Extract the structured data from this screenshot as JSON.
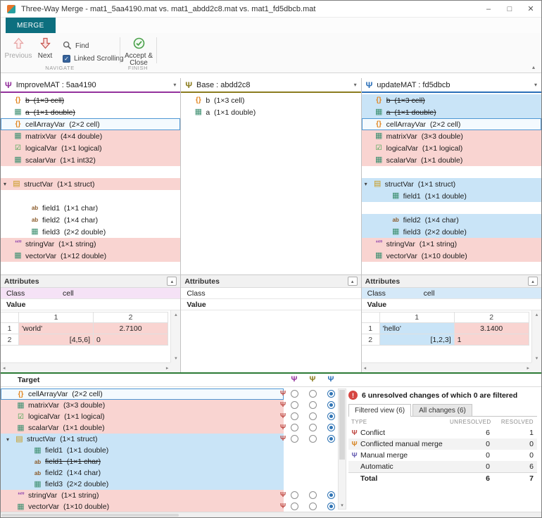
{
  "window": {
    "title": "Three-Way Merge - mat1_5aa4190.mat vs. mat1_abdd2c8.mat vs. mat1_fd5dbcb.mat",
    "controls": {
      "minimize": "–",
      "maximize": "□",
      "close": "✕"
    }
  },
  "ribbon": {
    "tab": "MERGE",
    "toolbar": {
      "previous": "Previous",
      "next": "Next",
      "find": "Find",
      "linked_scrolling": "Linked Scrolling",
      "accept_line1": "Accept &",
      "accept_line2": "Close",
      "navigate_label": "NAVIGATE",
      "finish_label": "FINISH"
    }
  },
  "icons": {
    "cell": "{}",
    "double": "▦",
    "int32": "▦",
    "logical": "☑",
    "struct": "▤",
    "char": "ab",
    "string": "“”",
    "branch": "Ψ",
    "expander": "▾",
    "chevron_down": "▾",
    "collapse": "▴",
    "scroll_up": "▴",
    "scroll_down": "▾",
    "scroll_left": "◂",
    "scroll_right": "▸",
    "alert": "!"
  },
  "colors": {
    "merge_tab": "#0d6f7f",
    "pink_diff": "#f9d4d1",
    "blue_diff": "#c9e4f7",
    "selection_border": "#4f97d4",
    "target_divider_green": "#2c7a36",
    "conflict_icon": "#bf4a44",
    "alert_red": "#d64541"
  },
  "panels": [
    {
      "title": "ImproveMAT : 5aa4190",
      "accent": "#93319c",
      "rows": [
        {
          "label": "b  (1×3 cell)",
          "type": "cell",
          "strike": true
        },
        {
          "label": "a  (1×1 double)",
          "type": "double",
          "strike": true
        },
        {
          "label": "cellArrayVar  (2×2 cell)",
          "type": "cell",
          "bg": "selected"
        },
        {
          "label": "matrixVar  (4×4 double)",
          "type": "double",
          "bg": "pink"
        },
        {
          "label": "logicalVar  (1×1 logical)",
          "type": "logical",
          "bg": "pink"
        },
        {
          "label": "scalarVar  (1×1 int32)",
          "type": "int32",
          "bg": "pink"
        },
        {
          "blank": true
        },
        {
          "label": "structVar  (1×1 struct)",
          "type": "struct",
          "bg": "pink",
          "expander": true
        },
        {
          "blank": true
        },
        {
          "label": "field1  (1×1 char)",
          "type": "char",
          "indent": 1
        },
        {
          "label": "field2  (1×4 char)",
          "type": "char",
          "indent": 1
        },
        {
          "label": "field3  (2×2 double)",
          "type": "double",
          "indent": 1
        },
        {
          "label": "stringVar  (1×1 string)",
          "type": "string",
          "bg": "pink"
        },
        {
          "label": "vectorVar  (1×12 double)",
          "type": "double",
          "bg": "pink"
        }
      ],
      "attributes": {
        "header": "Attributes",
        "class_label": "Class",
        "class_value": "cell",
        "class_hl": "purple",
        "value_label": "Value",
        "table": {
          "cols": [
            "1",
            "2"
          ],
          "rows": [
            {
              "h": "1",
              "cells": [
                {
                  "v": "'world'",
                  "hl": "pink",
                  "al": "l"
                },
                {
                  "v": "2.7100",
                  "hl": "pink",
                  "al": "c"
                }
              ]
            },
            {
              "h": "2",
              "cells": [
                {
                  "v": "[4,5,6]",
                  "hl": "pink",
                  "al": "r"
                },
                {
                  "v": "0",
                  "hl": "pink",
                  "al": "l"
                }
              ]
            }
          ]
        }
      }
    },
    {
      "title": "Base : abdd2c8",
      "accent": "#8b7c1e",
      "rows": [
        {
          "label": "b  (1×3 cell)",
          "type": "cell"
        },
        {
          "label": "a  (1×1 double)",
          "type": "double"
        }
      ],
      "attributes": {
        "header": "Attributes",
        "class_label": "Class",
        "class_value": "",
        "class_hl": "none",
        "value_label": "Value",
        "table": {
          "cols": [],
          "rows": []
        }
      }
    },
    {
      "title": "updateMAT : fd5dbcb",
      "accent": "#2a6fb8",
      "rows": [
        {
          "label": "b  (1×3 cell)",
          "type": "cell",
          "strike": true,
          "bg": "blue"
        },
        {
          "label": "a  (1×1 double)",
          "type": "double",
          "strike": true,
          "bg": "blue"
        },
        {
          "label": "cellArrayVar  (2×2 cell)",
          "type": "cell",
          "bg": "selected"
        },
        {
          "label": "matrixVar  (3×3 double)",
          "type": "double",
          "bg": "pink"
        },
        {
          "label": "logicalVar  (1×1 logical)",
          "type": "logical",
          "bg": "pink"
        },
        {
          "label": "scalarVar  (1×1 double)",
          "type": "double",
          "bg": "pink"
        },
        {
          "blank": true
        },
        {
          "label": "structVar  (1×1 struct)",
          "type": "struct",
          "bg": "blue",
          "expander": true
        },
        {
          "label": "field1  (1×1 double)",
          "type": "double",
          "indent": 1,
          "bg": "blue"
        },
        {
          "blank": true
        },
        {
          "label": "field2  (1×4 char)",
          "type": "char",
          "indent": 1,
          "bg": "blue"
        },
        {
          "label": "field3  (2×2 double)",
          "type": "double",
          "indent": 1,
          "bg": "blue"
        },
        {
          "label": "stringVar  (1×1 string)",
          "type": "string",
          "bg": "pink"
        },
        {
          "label": "vectorVar  (1×10 double)",
          "type": "double",
          "bg": "pink"
        }
      ],
      "attributes": {
        "header": "Attributes",
        "class_label": "Class",
        "class_value": "cell",
        "class_hl": "blue",
        "value_label": "Value",
        "table": {
          "cols": [
            "1",
            "2"
          ],
          "rows": [
            {
              "h": "1",
              "cells": [
                {
                  "v": "'hello'",
                  "hl": "blue",
                  "al": "l"
                },
                {
                  "v": "3.1400",
                  "hl": "pink",
                  "al": "c"
                }
              ]
            },
            {
              "h": "2",
              "cells": [
                {
                  "v": "[1,2,3]",
                  "hl": "blue",
                  "al": "r"
                },
                {
                  "v": "1",
                  "hl": "pink",
                  "al": "l"
                }
              ]
            }
          ]
        }
      }
    }
  ],
  "target": {
    "title": "Target",
    "rows": [
      {
        "label": "cellArrayVar  (2×2 cell)",
        "type": "cell",
        "bg": "selected",
        "conflict": true,
        "choice": 3
      },
      {
        "label": "matrixVar  (3×3 double)",
        "type": "double",
        "bg": "pink",
        "conflict": true,
        "choice": 3
      },
      {
        "label": "logicalVar  (1×1 logical)",
        "type": "logical",
        "bg": "pink",
        "conflict": true,
        "choice": 3
      },
      {
        "label": "scalarVar  (1×1 double)",
        "type": "double",
        "bg": "pink",
        "conflict": true,
        "choice": 3
      },
      {
        "label": "structVar  (1×1 struct)",
        "type": "struct",
        "bg": "blue",
        "expander": true,
        "conflict": true,
        "choice": 3
      },
      {
        "label": "field1  (1×1 double)",
        "type": "double",
        "indent": 1,
        "bg": "blue"
      },
      {
        "label": "field1  (1×1 char)",
        "type": "char",
        "indent": 1,
        "bg": "blue",
        "strike": true
      },
      {
        "label": "field2  (1×4 char)",
        "type": "char",
        "indent": 1,
        "bg": "blue"
      },
      {
        "label": "field3  (2×2 double)",
        "type": "double",
        "indent": 1,
        "bg": "blue"
      },
      {
        "label": "stringVar  (1×1 string)",
        "type": "string",
        "bg": "pink",
        "conflict": true,
        "choice": 3
      },
      {
        "label": "vectorVar  (1×10 double)",
        "type": "double",
        "bg": "pink",
        "conflict": true,
        "choice": 3
      }
    ]
  },
  "summary": {
    "alert_icon": "!",
    "alert_text": "6 unresolved changes of which 0 are filtered",
    "tabs": [
      {
        "label": "Filtered view (6)",
        "active": true
      },
      {
        "label": "All changes (6)",
        "active": false
      }
    ],
    "headers": {
      "type": "TYPE",
      "unresolved": "UNRESOLVED",
      "resolved": "RESOLVED"
    },
    "rows": [
      {
        "icon": "conflict",
        "label": "Conflict",
        "unresolved": "6",
        "resolved": "1"
      },
      {
        "icon": "conflicted-manual",
        "label": "Conflicted manual merge",
        "unresolved": "0",
        "resolved": "0"
      },
      {
        "icon": "manual",
        "label": "Manual merge",
        "unresolved": "0",
        "resolved": "0"
      },
      {
        "icon": "",
        "label": "Automatic",
        "unresolved": "0",
        "resolved": "6"
      },
      {
        "icon": "",
        "label": "Total",
        "unresolved": "6",
        "resolved": "7",
        "total": true
      }
    ]
  }
}
